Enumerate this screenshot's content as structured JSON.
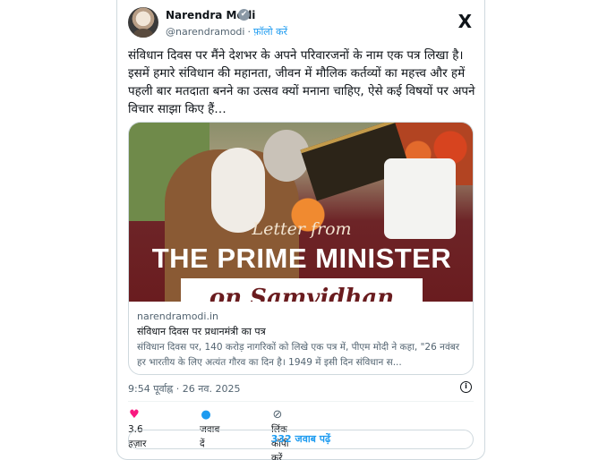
{
  "author": {
    "name": "Narendra Modi",
    "handle": "@narendramodi",
    "separator": "·",
    "follow_label": "फ़ॉलो करें",
    "verified_glyph": "✔"
  },
  "platform_logo": "X",
  "tweet_text": "संविधान दिवस पर मैंने देशभर के अपने परिवारजनों के नाम एक पत्र लिखा है। इसमें हमारे संविधान की महानता, जीवन में मौलिक कर्तव्यों का महत्त्व और हमें पहली बार मतदाता बनने का उत्सव क्यों मनाना चाहिए, ऐसे कई विषयों पर अपने विचार साझा किए हैं…",
  "link_card": {
    "image_script_text": "Letter from",
    "image_title": "THE PRIME MINISTER",
    "image_band_text": "on Samvidhan Diwas",
    "domain": "narendramodi.in",
    "title": "संविधान दिवस पर प्रधानमंत्री का पत्र",
    "description": "संविधान दिवस पर, 140 करोड़ नागरिकों को लिखे एक पत्र में, पीएम मोदी ने कहा, \"26 नवंबर हर भारतीय के लिए अत्यंत गौरव का दिन है। 1949 में इसी दिन संविधान स..."
  },
  "timestamp": "9:54 पूर्वाह्न · 26 नव. 2025",
  "actions": {
    "likes": "3.6 हज़ार",
    "reply_label": "जवाब दें",
    "copy_link_label": "लिंक कॉपी करें"
  },
  "replies_button": "332 जवाब पढ़ें",
  "icons": {
    "heart": "heart-icon",
    "reply": "reply-bubble-icon",
    "link": "link-icon",
    "info": "info-icon"
  },
  "colors": {
    "accent": "#1d9bf0",
    "like": "#f91880",
    "text": "#0f1419",
    "muted": "#536471"
  }
}
